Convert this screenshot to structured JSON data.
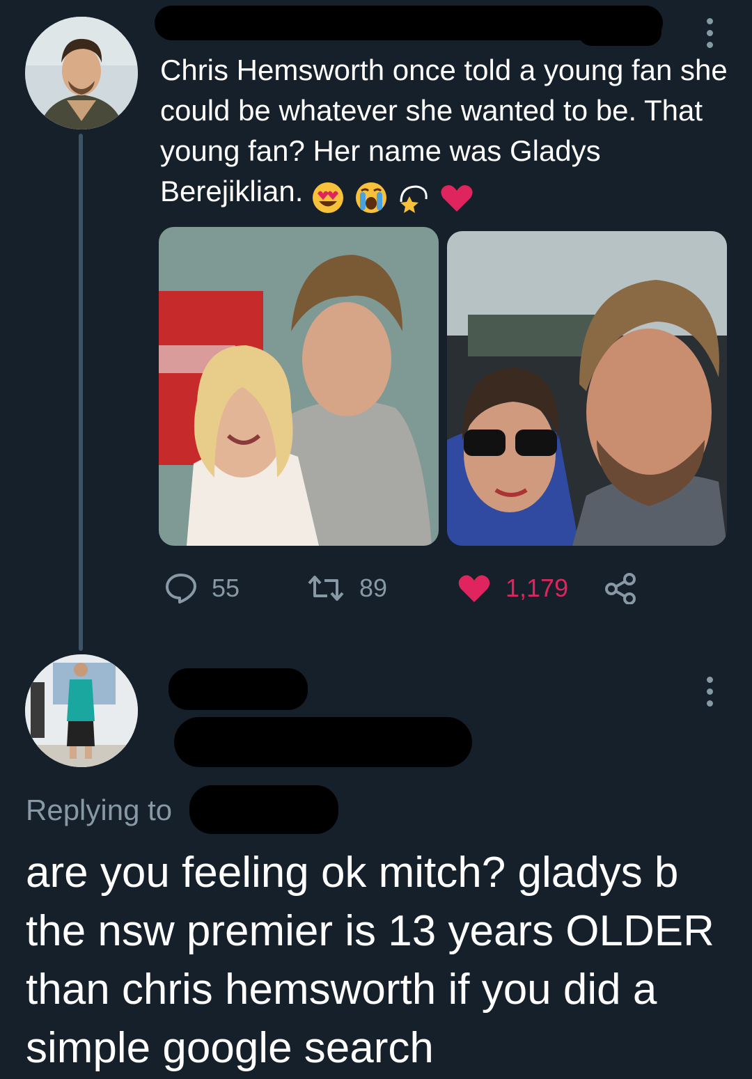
{
  "tweet": {
    "text": "Chris Hemsworth once told a young fan she could be whatever she wanted to be. That young fan? Her name was Gladys Berejiklian.",
    "emojis": [
      "heart-eyes-emoji",
      "crying-face-emoji",
      "dizzy-emoji",
      "red-heart-emoji"
    ],
    "stats": {
      "replies": "55",
      "retweets": "89",
      "likes": "1,179"
    },
    "like_color": "#e0245e"
  },
  "reply": {
    "replying_to_label": "Replying to",
    "text": "are you feeling ok mitch? gladys b the nsw premier is 13 years OLDER than chris hemsworth if you did a simple google search"
  },
  "icons": {
    "reply": "reply-bubble-icon",
    "retweet": "retweet-icon",
    "like": "heart-filled-icon",
    "share": "share-icon",
    "more": "more-dots-icon"
  },
  "colors": {
    "background": "#15202b",
    "secondary_text": "#8899a6",
    "thread_line": "#3d5466"
  }
}
